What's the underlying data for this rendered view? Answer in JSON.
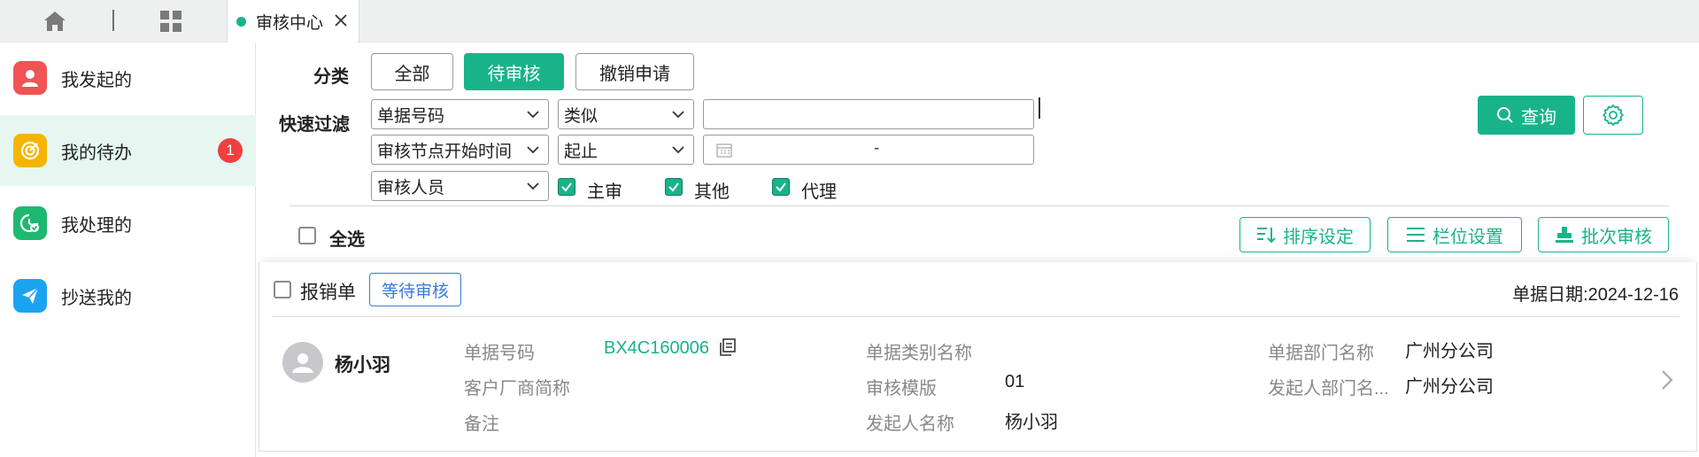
{
  "topbar": {
    "home_icon": "home-icon",
    "apps_icon": "apps-grid-icon",
    "tab": {
      "label": "审核中心",
      "dot_color": "#19b38a",
      "close_icon": "close-icon"
    }
  },
  "sidebar": {
    "items": [
      {
        "label": "我发起的",
        "icon": "user-icon",
        "icon_bg": "#f05454",
        "active": false
      },
      {
        "label": "我的待办",
        "icon": "target-icon",
        "icon_bg": "#f5b400",
        "active": true,
        "badge": "1"
      },
      {
        "label": "我处理的",
        "icon": "check-clock-icon",
        "icon_bg": "#1fb870",
        "active": false
      },
      {
        "label": "抄送我的",
        "icon": "send-icon",
        "icon_bg": "#1ca3f0",
        "active": false
      }
    ]
  },
  "filters": {
    "category_label": "分类",
    "categories": [
      "全部",
      "待审核",
      "撤销申请"
    ],
    "selected_category": "待审核",
    "quick_filter_label": "快速过滤",
    "row1": {
      "field": "单据号码",
      "operator": "类似",
      "value": ""
    },
    "row2": {
      "field": "审核节点开始时间",
      "operator": "起止",
      "date_separator": "-"
    },
    "row3": {
      "field": "审核人员",
      "checks": [
        {
          "label": "主审",
          "checked": true
        },
        {
          "label": "其他",
          "checked": true
        },
        {
          "label": "代理",
          "checked": true
        }
      ]
    },
    "query_button": "查询",
    "settings_icon": "gear-icon"
  },
  "toolbar": {
    "select_all_label": "全选",
    "sort_button": "排序设定",
    "columns_button": "栏位设置",
    "batch_button": "批次审核"
  },
  "record": {
    "type": "报销单",
    "status": "等待审核",
    "date_label": "单据日期:2024-12-16",
    "person": "杨小羽",
    "fields": {
      "doc_no_label": "单据号码",
      "doc_no_value": "BX4C160006",
      "customer_label": "客户厂商简称",
      "customer_value": "",
      "note_label": "备注",
      "note_value": "",
      "type_name_label": "单据类别名称",
      "type_name_value": "",
      "template_label": "审核模版",
      "template_value": "01",
      "initiator_label": "发起人名称",
      "initiator_value": "杨小羽",
      "dept_label": "单据部门名称",
      "dept_value": "广州分公司",
      "initiator_dept_label": "发起人部门名...",
      "initiator_dept_value": "广州分公司"
    }
  },
  "colors": {
    "accent": "#19b38a",
    "badge_red": "#ef4040",
    "status_blue": "#3a7bd5"
  }
}
